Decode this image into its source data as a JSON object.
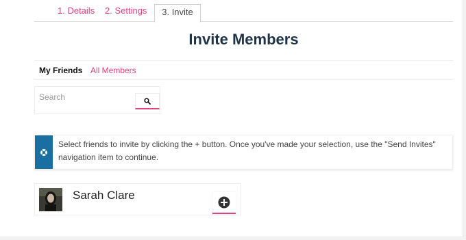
{
  "tabs": [
    {
      "label": "1. Details"
    },
    {
      "label": "2. Settings"
    },
    {
      "label": "3. Invite"
    }
  ],
  "title": "Invite Members",
  "subnav": {
    "my_friends": "My Friends",
    "all_members": "All Members"
  },
  "search": {
    "placeholder": "Search",
    "button_icon": "search-icon"
  },
  "notice": {
    "icon": "lifebuoy-icon",
    "message": "Select friends to invite by clicking the + button. Once you've made your selection, use the \"Send Invites\" navigation item to continue."
  },
  "members": [
    {
      "name": "Sarah Clare",
      "action_icon": "plus-circle-icon"
    }
  ],
  "colors": {
    "accent": "#e0437f",
    "title": "#1f3347",
    "notice_bar": "#1a6fa0"
  }
}
